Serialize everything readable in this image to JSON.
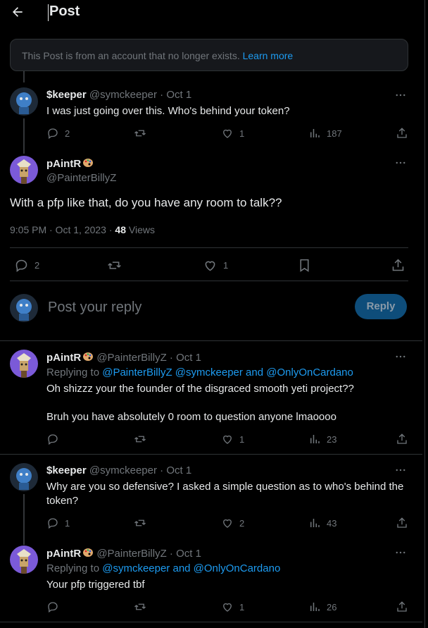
{
  "header": {
    "title": "Post"
  },
  "notice": {
    "text": "This Post is from an account that no longer exists.",
    "link": "Learn more"
  },
  "parent_tweet": {
    "name": "$keeper",
    "handle": "@symckeeper",
    "date": "· Oct 1",
    "text": "I was just going over this. Who's behind your token?",
    "replies": "2",
    "likes": "1",
    "views": "187"
  },
  "main_tweet": {
    "name": "pAintR",
    "handle": "@PainterBillyZ",
    "text": "With a pfp like that, do you have any room to talk??",
    "timestamp": "9:05 PM · Oct 1, 2023 · ",
    "views_count": "48",
    "views_label": " Views",
    "replies": "2",
    "likes": "1"
  },
  "reply_box": {
    "placeholder": "Post your reply",
    "button": "Reply"
  },
  "replies": [
    {
      "name": "pAintR",
      "handle": "@PainterBillyZ",
      "date": "· Oct 1",
      "replying_prefix": "Replying to ",
      "replying_to": "@PainterBillyZ @symckeeper and @OnlyOnCardano",
      "line1": "Oh shizzz your the founder of the disgraced smooth yeti project??",
      "line2": "Bruh you have absolutely 0 room to question anyone lmaoooo",
      "replies": "",
      "likes": "1",
      "views": "23"
    },
    {
      "name": "$keeper",
      "handle": "@symckeeper",
      "date": "· Oct 1",
      "line1": "Why are you so defensive? I asked a simple question as to who's behind the",
      "line2": "token?",
      "replies": "1",
      "likes": "2",
      "views": "43"
    },
    {
      "name": "pAintR",
      "handle": "@PainterBillyZ",
      "date": "· Oct 1",
      "replying_prefix": "Replying to ",
      "replying_to": "@symckeeper and @OnlyOnCardano",
      "line1": "Your pfp triggered tbf",
      "replies": "",
      "likes": "1",
      "views": "26"
    }
  ],
  "colors": {
    "accent": "#1d9bf0",
    "background": "#000000",
    "muted": "#71767b",
    "border": "#2f3336"
  },
  "icons": [
    "back-arrow-icon",
    "more-icon",
    "reply-icon",
    "repost-icon",
    "like-icon",
    "views-icon",
    "share-icon",
    "bookmark-icon",
    "palette-emoji-icon"
  ]
}
